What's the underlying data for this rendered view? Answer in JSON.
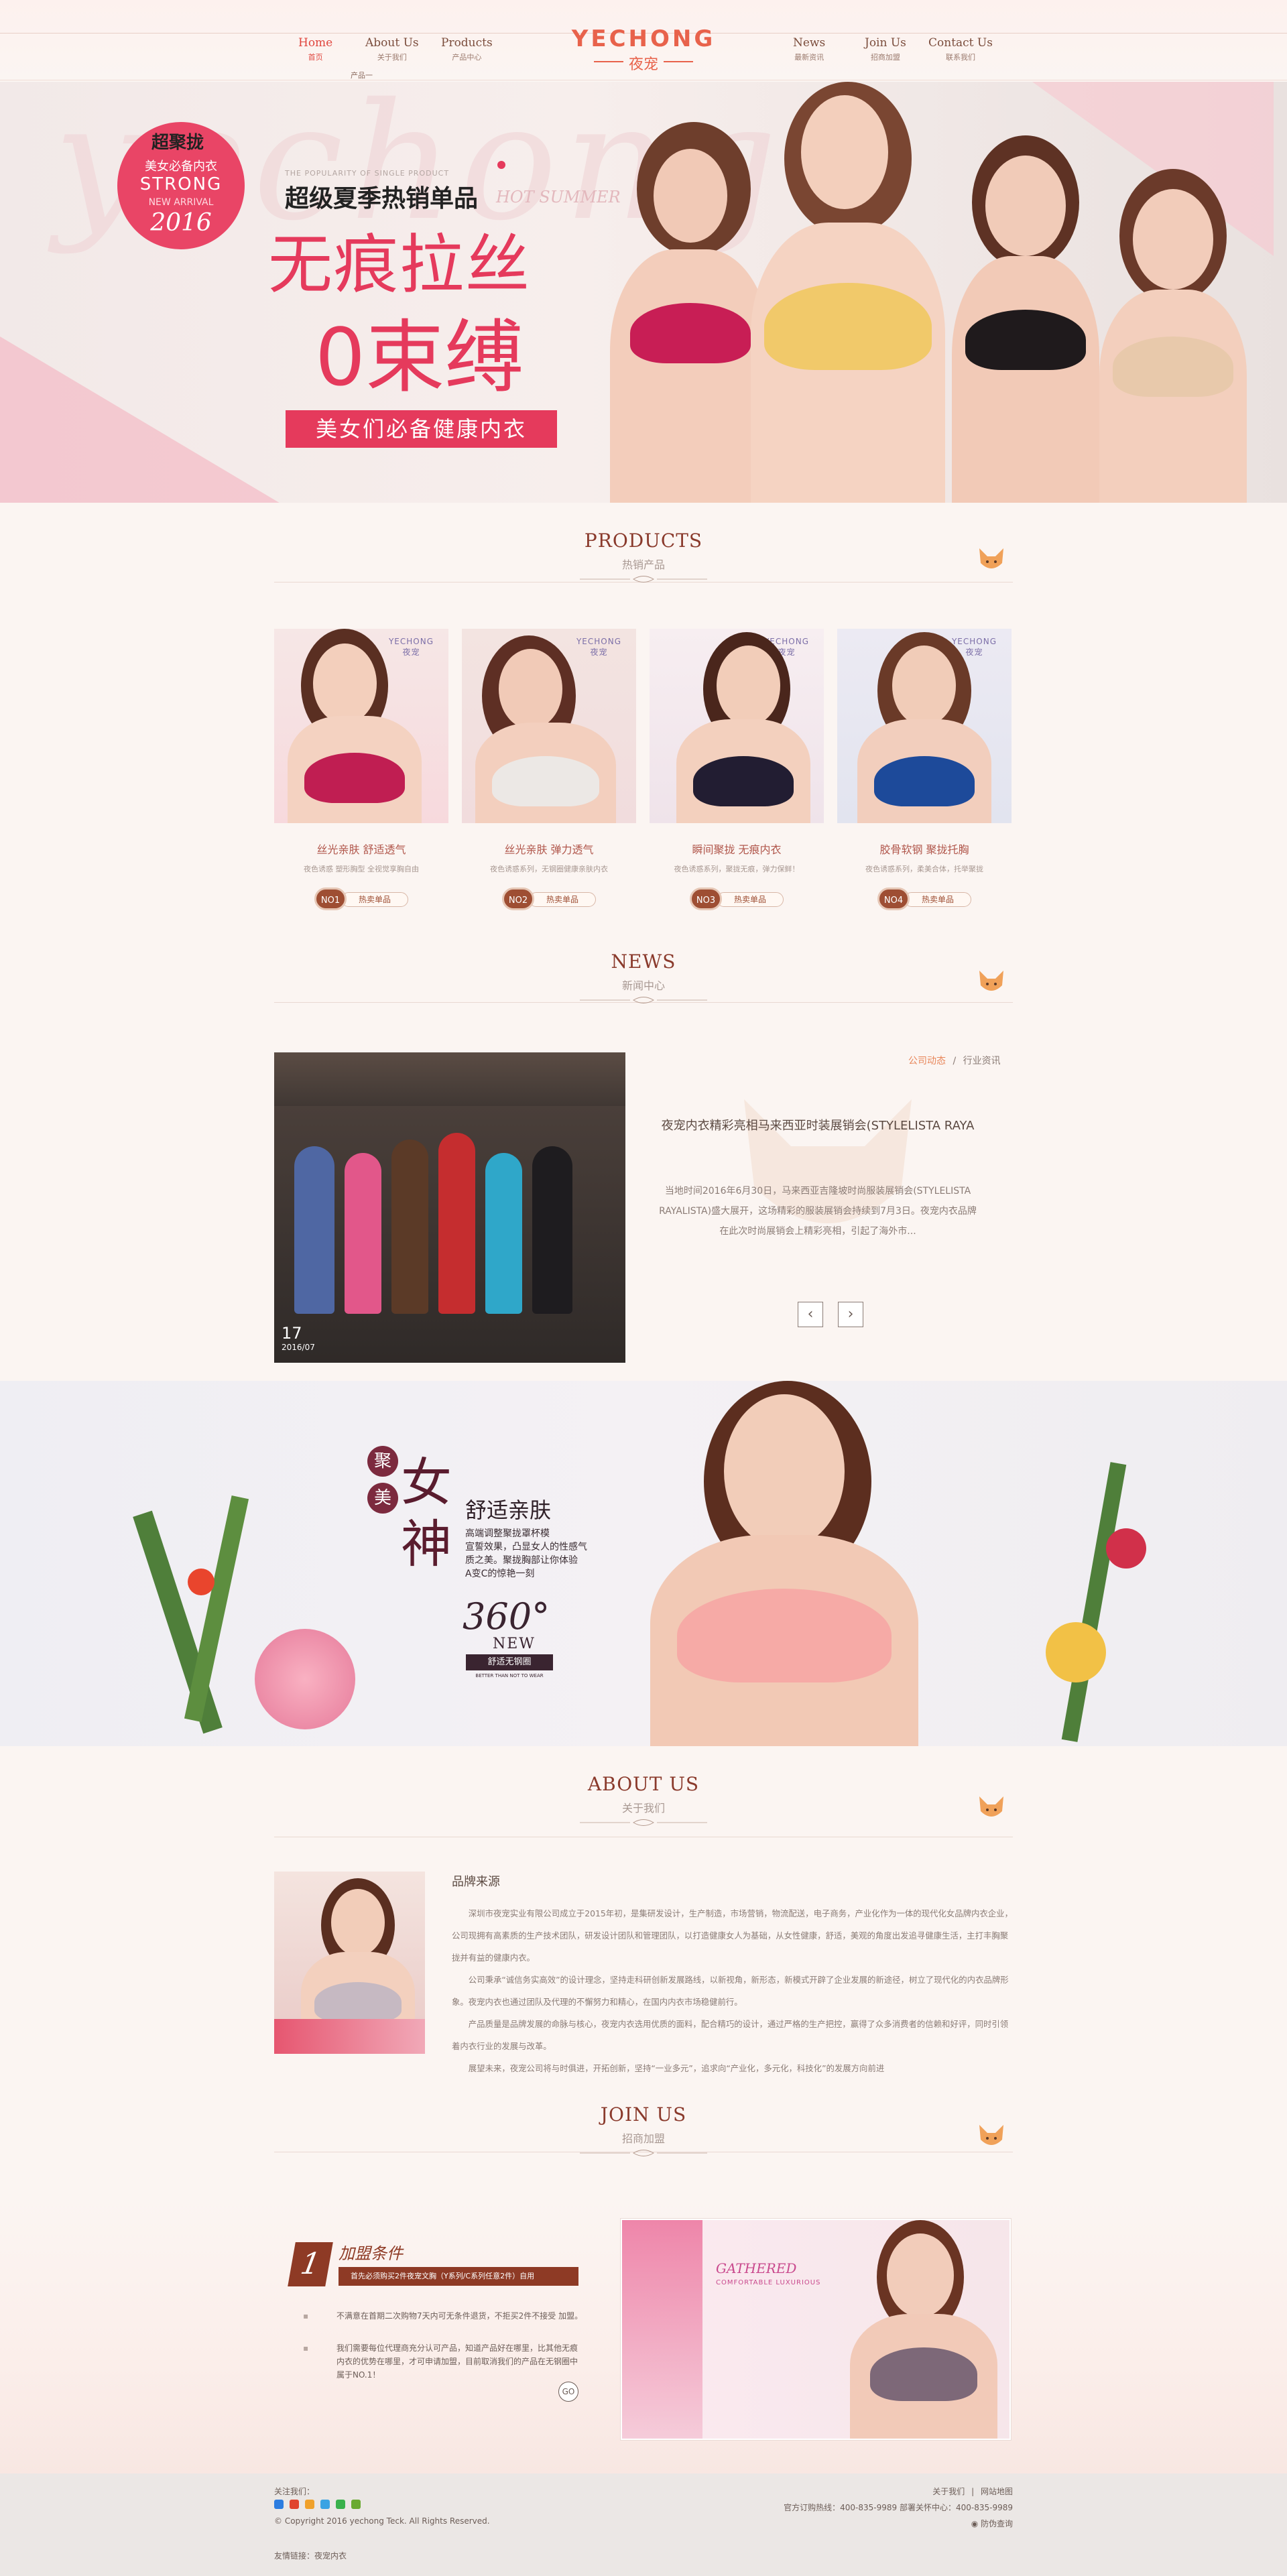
{
  "nav": {
    "items": [
      {
        "en": "Home",
        "cn": "首页"
      },
      {
        "en": "About Us",
        "cn": "关于我们"
      },
      {
        "en": "Products",
        "cn": "产品中心"
      },
      {
        "en": "News",
        "cn": "最新资讯"
      },
      {
        "en": "Join Us",
        "cn": "招商加盟"
      },
      {
        "en": "Contact Us",
        "cn": "联系我们"
      }
    ],
    "logo_en": "YECHONG",
    "logo_cn": "夜宠",
    "dropdown": "产品一"
  },
  "banner": {
    "bg_text": "yechong",
    "badge_top": "超聚拢",
    "badge_line": "美女必备内衣",
    "badge_strong": "STRONG",
    "badge_arrival": "NEW ARRIVAL",
    "badge_year": "2016",
    "small_en": "THE POPULARITY OF SINGLE PRODUCT",
    "line1": "超级夏季热销单品",
    "line1_en": "HOT SUMMER",
    "line2": "无痕拉丝",
    "line3": "0束缚",
    "line4": "美女们必备健康内衣"
  },
  "products": {
    "title_en": "PRODUCTS",
    "title_cn": "热销产品",
    "brand_en": "YECHONG",
    "brand_cn": "夜宠",
    "tag_label": "热卖单品",
    "items": [
      {
        "no": "NO1",
        "name": "丝光亲肤 舒适透气",
        "desc": "夜色诱惑 塑形胸型 全视觉享胸自由"
      },
      {
        "no": "NO2",
        "name": "丝光亲肤 弹力透气",
        "desc": "夜色诱惑系列，无钢圈健康亲肤内衣"
      },
      {
        "no": "NO3",
        "name": "瞬间聚拢 无痕内衣",
        "desc": "夜色诱惑系列，聚拢无痕，弹力保鲜！"
      },
      {
        "no": "NO4",
        "name": "胶骨软钢 聚拢托胸",
        "desc": "夜色诱惑系列，柔美合体，托举聚拢"
      }
    ]
  },
  "news": {
    "title_en": "NEWS",
    "title_cn": "新闻中心",
    "crumb_active": "公司动态",
    "crumb_sep": "/",
    "crumb_other": "行业资讯",
    "day": "17",
    "month": "2016/07",
    "headline": "夜宠内衣精彩亮相马来西亚时装展销会(STYLELISTA RAYA",
    "body": "当地时间2016年6月30日，马来西亚吉隆坡时尚服装展销会(STYLELISTA RAYALISTA)盛大展开，这场精彩的服装展销会持续到7月3日。夜宠内衣品牌在此次时尚展销会上精彩亮相，引起了海外市...",
    "prev": "‹",
    "next": "›"
  },
  "promo": {
    "c1": "聚",
    "c2": "美",
    "c3": "女",
    "c4": "神",
    "slogan": "舒适亲肤",
    "desc": [
      "高端调整聚拢罩杯模",
      "宣誓效果，凸显女人的性感气",
      "质之美。聚拢胸部让你体验",
      "A变C的惊艳一刻"
    ],
    "n360": "360°",
    "new": "NEW",
    "tag": "舒适无钢圈",
    "tag_en": "BETTER THAN NOT TO WEAR"
  },
  "about": {
    "title_en": "ABOUT US",
    "title_cn": "关于我们",
    "heading": "品牌来源",
    "paras": [
      "深圳市夜宠实业有限公司成立于2015年初，是集研发设计，生产制造，市场营销，物流配送，电子商务，产业化作为一体的现代化女品牌内衣企业，公司现拥有高素质的生产技术团队，研发设计团队和管理团队，以打造健康女人为基础，从女性健康，舒适，美观的角度出发追寻健康生活，主打丰胸聚拢并有益的健康内衣。",
      "公司秉承“诚信务实高效”的设计理念，坚持走科研创新发展路线，以新视角，新形态，新模式开辟了企业发展的新途径，树立了现代化的内衣品牌形象。夜宠内衣也通过团队及代理的不懈努力和精心，在国内内衣市场稳健前行。",
      "产品质量是品牌发展的命脉与核心，夜宠内衣选用优质的面料，配合精巧的设计，通过严格的生产把控，赢得了众多消费者的信赖和好评，同时引领着内衣行业的发展与改革。",
      "展望未来，夜宠公司将与时俱进，开拓创新，坚持“一业多元”，追求向“产业化，多元化，科技化”的发展方向前进"
    ]
  },
  "join": {
    "title_en": "JOIN US",
    "title_cn": "招商加盟",
    "num": "1",
    "cond_title": "加盟条件",
    "cond_bar": "首先必须购买2件夜宠文胸（Y系列/C系列任意2件）自用",
    "list": [
      "不满意在首期二次购物7天内可无条件退货，不拒买2件不接受 加盟。",
      "我们需要每位代理商充分认可产品，知道产品好在哪里，比其他无痕内衣的优势在哪里，才可申请加盟，目前取消我们的产品在无钢圈中属于NO.1！"
    ],
    "go": "GO",
    "pic_text": "GATHERED",
    "pic_sub": "COMFORTABLE LUXURIOUS"
  },
  "footer": {
    "follow": "关注我们：",
    "copyright": "© Copyright 2016 yechong Teck. All Rights Reserved.",
    "links": "友情链接：夜宠内衣",
    "r1a": "关于我们",
    "r1sep": "|",
    "r1b": "网站地图",
    "r2": "官方订购热线：400-835-9989 部署关怀中心：400-835-9989",
    "r3": "防伪查询"
  },
  "colors": {
    "accent": "#e53a5c",
    "brown": "#8a3a2c",
    "logo": "#e8624b"
  }
}
